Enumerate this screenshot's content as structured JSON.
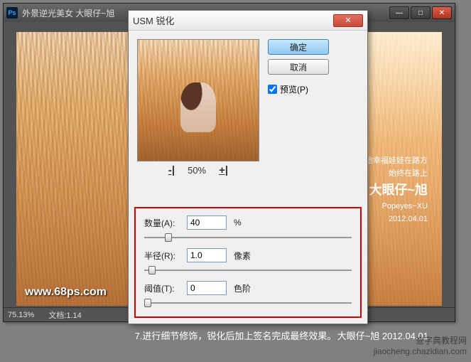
{
  "ps_window": {
    "icon_text": "Ps",
    "title": "外景逆光美女   大眼仔~旭",
    "min": "—",
    "max": "□",
    "close": "✕",
    "status_zoom": "75.13%",
    "status_doc": "文档:1.14",
    "watermark": "www.68ps.com",
    "canvas_overlay": {
      "line1": "旅途幸福娃娃在路方",
      "line2": "始终在路上",
      "line3": "大眼仔~旭",
      "line4": "Popeyes~XU",
      "line5": "2012.04.01"
    }
  },
  "dialog": {
    "title": "USM 锐化",
    "close": "✕",
    "ok": "确定",
    "cancel": "取消",
    "preview_label": "预览(P)",
    "preview_checked": true,
    "zoom_minus": "-|",
    "zoom_value": "50%",
    "zoom_plus": "+|",
    "params": {
      "amount_label": "数量(A):",
      "amount_value": "40",
      "amount_unit": "%",
      "radius_label": "半径(R):",
      "radius_value": "1.0",
      "radius_unit": "像素",
      "threshold_label": "阈值(T):",
      "threshold_value": "0",
      "threshold_unit": "色阶"
    }
  },
  "caption": {
    "main": "7.进行细节修饰，锐化后加上签名完成最终效果。",
    "right": "大眼仔~旭  2012.04.01"
  },
  "site_watermark": {
    "line1": "查字典教程网",
    "line2": "jiaocheng.chazidian.com"
  }
}
